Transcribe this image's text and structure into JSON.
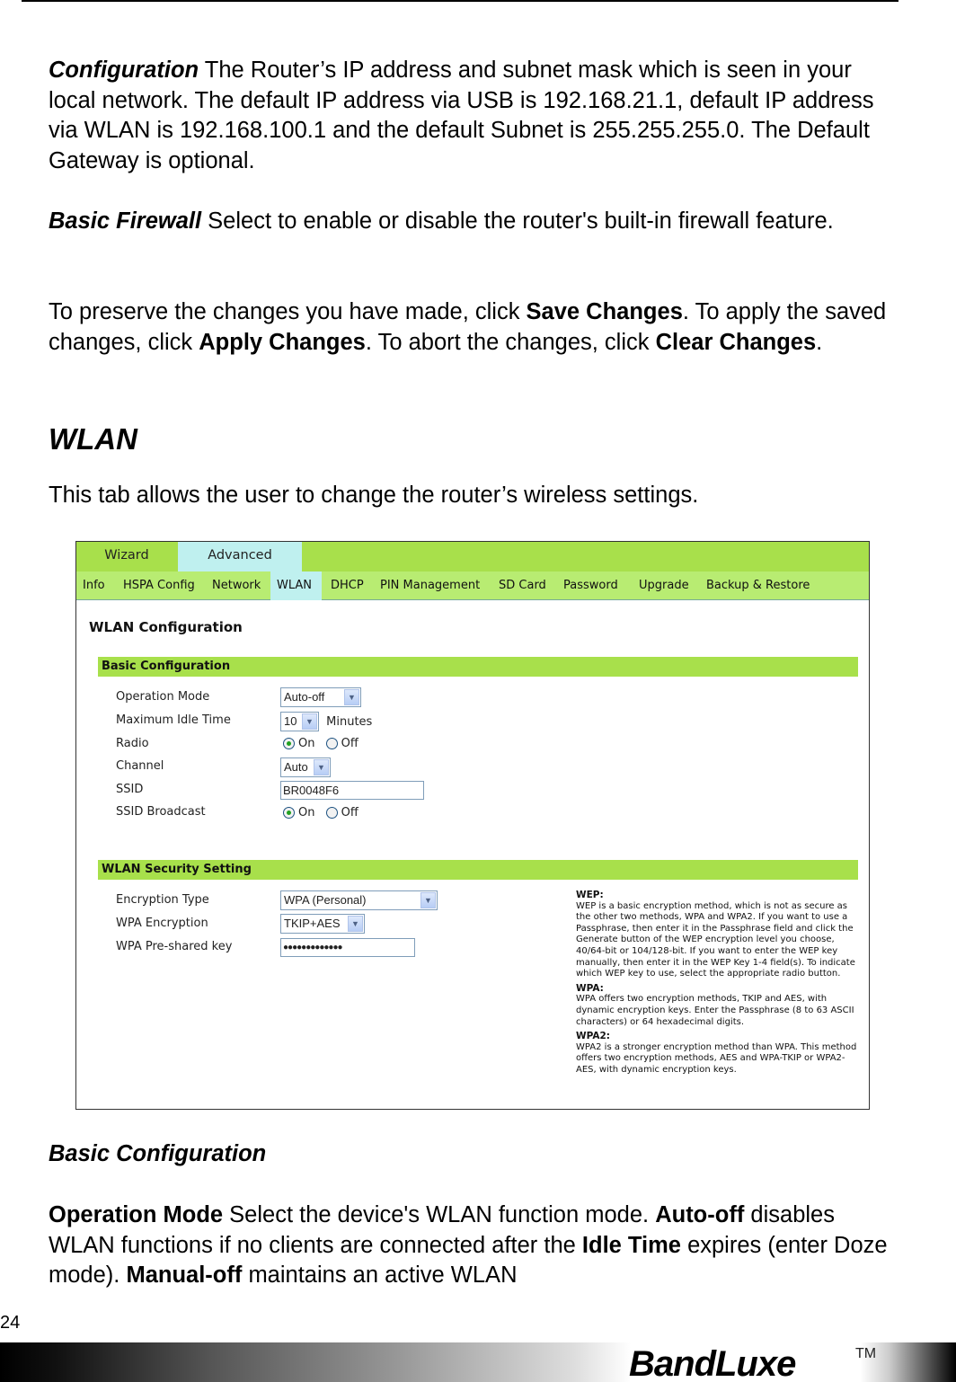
{
  "doc": {
    "config_para": {
      "term": "Configuration",
      "text": " The Router’s IP address and subnet mask which is seen in your local network. The default IP address via USB is 192.168.21.1, default IP address via WLAN is 192.168.100.1 and the default Subnet is 255.255.255.0. The Default Gateway is optional."
    },
    "firewall_para": {
      "term": "Basic Firewall",
      "text": " Select to enable or disable the router's built-in firewall feature."
    },
    "save_para": {
      "t1": "To preserve the changes you have made, click ",
      "b1": "Save Changes",
      "t2": ". To apply the saved changes, click ",
      "b2": "Apply Changes",
      "t3": ". To abort the changes, click ",
      "b3": "Clear Changes",
      "t4": "."
    },
    "wlan_heading": "WLAN",
    "wlan_intro": "This tab allows the user to change the router’s wireless settings.",
    "basic_heading": "Basic Configuration",
    "opmode_para": {
      "b1": "Operation Mode",
      "t1": " Select the device's WLAN function mode. ",
      "b2": "Auto-off",
      "t2": " disables WLAN functions if no clients are connected after the ",
      "b3": "Idle Time",
      "t3": " expires (enter Doze mode). ",
      "b4": "Manual-off",
      "t4": " maintains an active WLAN"
    },
    "page_number": "24",
    "brand": "BandLuxe",
    "trademark": "TM"
  },
  "ui": {
    "top_tabs": [
      {
        "label": "Wizard",
        "active": false
      },
      {
        "label": "Advanced",
        "active": true
      }
    ],
    "sub_tabs": [
      {
        "label": "Info"
      },
      {
        "label": "HSPA Config"
      },
      {
        "label": "Network"
      },
      {
        "label": "WLAN",
        "active": true
      },
      {
        "label": "DHCP"
      },
      {
        "label": "PIN Management"
      },
      {
        "label": "SD Card"
      },
      {
        "label": "Password"
      },
      {
        "label": "Upgrade"
      },
      {
        "label": "Backup & Restore"
      }
    ],
    "page_title": "WLAN Configuration",
    "basic": {
      "title": "Basic Configuration",
      "operation_mode": {
        "label": "Operation Mode",
        "value": "Auto-off"
      },
      "idle_time": {
        "label": "Maximum Idle Time",
        "value": "10",
        "unit": "Minutes"
      },
      "radio": {
        "label": "Radio",
        "on": "On",
        "off": "Off",
        "selected": "On"
      },
      "channel": {
        "label": "Channel",
        "value": "Auto"
      },
      "ssid": {
        "label": "SSID",
        "value": "BR0048F6"
      },
      "ssid_broadcast": {
        "label": "SSID Broadcast",
        "on": "On",
        "off": "Off",
        "selected": "On"
      }
    },
    "security": {
      "title": "WLAN Security Setting",
      "encryption_type": {
        "label": "Encryption Type",
        "value": "WPA (Personal)"
      },
      "wpa_encryption": {
        "label": "WPA Encryption",
        "value": "TKIP+AES"
      },
      "psk": {
        "label": "WPA Pre-shared key",
        "value": "●●●●●●●●●●●●●"
      }
    },
    "help": {
      "wep_title": "WEP:",
      "wep_text": "WEP is a basic encryption method, which is not as secure as the other two methods, WPA and WPA2. If you want to use a Passphrase, then enter it in the Passphrase field and click the Generate button of the WEP encryption level you choose, 40/64-bit or 104/128-bit. If you want to enter the WEP key manually, then enter it in the WEP Key 1-4 field(s). To indicate which WEP key to use, select the appropriate radio button.",
      "wpa_title": "WPA:",
      "wpa_text": "WPA offers two encryption methods, TKIP and AES, with dynamic encryption keys. Enter the Passphrase (8 to 63 ASCII characters) or 64 hexadecimal digits.",
      "wpa2_title": "WPA2:",
      "wpa2_text": "WPA2 is a stronger encryption method than WPA. This method offers two encryption methods, AES and WPA-TKIP or WPA2-AES, with dynamic encryption keys."
    }
  }
}
